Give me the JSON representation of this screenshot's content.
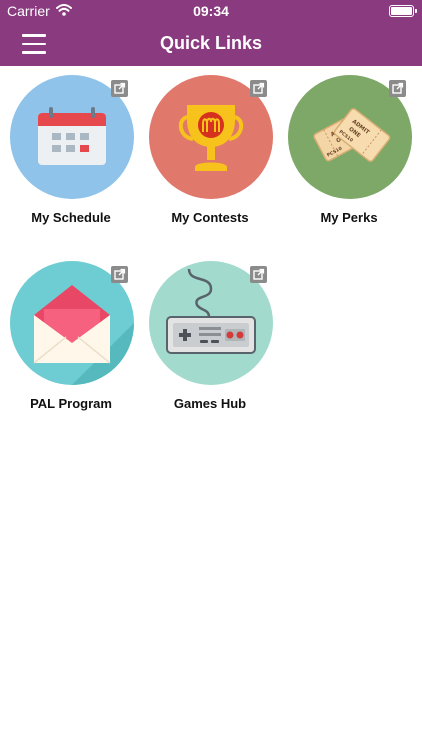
{
  "status_bar": {
    "carrier": "Carrier",
    "time": "09:34"
  },
  "nav": {
    "title": "Quick Links"
  },
  "links": [
    {
      "label": "My Schedule",
      "bg": "#8fc3ea",
      "icon": "calendar-icon"
    },
    {
      "label": "My Contests",
      "bg": "#e0786b",
      "icon": "trophy-icon"
    },
    {
      "label": "My Perks",
      "bg": "#7da867",
      "icon": "tickets-icon"
    },
    {
      "label": "PAL Program",
      "bg": "#6dcdd2",
      "icon": "envelope-icon"
    },
    {
      "label": "Games Hub",
      "bg": "#a2dbcd",
      "icon": "gamepad-icon"
    }
  ],
  "ticket_text": [
    "ADMIT",
    "ONE",
    "PCS10"
  ],
  "colors": {
    "brand": "#8a3a7f",
    "external_badge": "#8b8b8b"
  }
}
